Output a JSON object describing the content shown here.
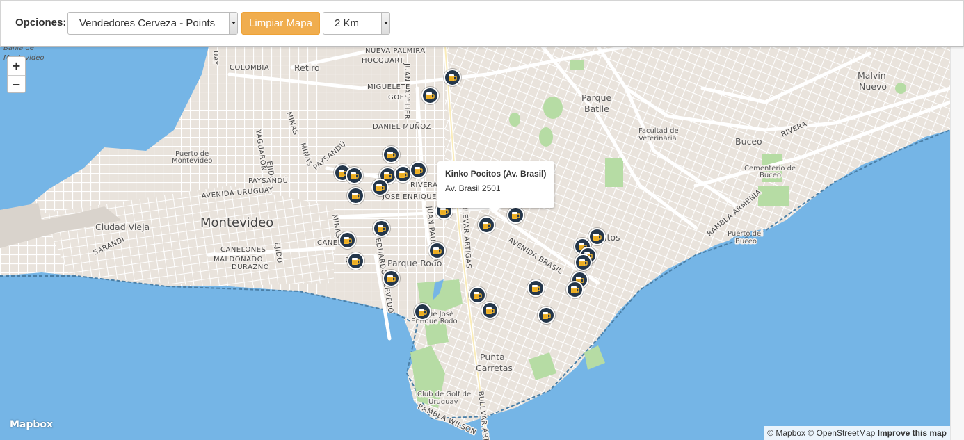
{
  "toolbar": {
    "options_label": "Opciones:",
    "layer_select": "Vendedores Cerveza - Points",
    "clear_button": "Limpiar Mapa",
    "radius_select": "2 Km",
    "accent_color": "#f0ad4e"
  },
  "map": {
    "zoom_in": "+",
    "zoom_out": "−",
    "popup": {
      "name": "Kinko Pocitos (Av. Brasil)",
      "address": "Av. Brasil 2501"
    },
    "marker_icon": "beer-mug-icon",
    "marker_count": 34,
    "logo": "Mapbox",
    "attribution": {
      "mapbox": "© Mapbox",
      "osm": "© OpenStreetMap",
      "improve": "Improve this map"
    },
    "labels": {
      "bahia": [
        "Bahía de",
        "Montevideo"
      ],
      "colombia": "COLOMBIA",
      "retiro": "Retiro",
      "nueva_palmira": "NUEVA PALMIRA",
      "hocquart": "HOCQUART",
      "juan_paullier": "JUAN PAULLIER",
      "miguelete": "MIGUELETE",
      "goes": "GOES",
      "daniel_munoz": "DANIEL MUÑOZ",
      "parque_batle": [
        "Parque",
        "Batlle"
      ],
      "malvin_nuevo": [
        "Malvín",
        "Nuevo"
      ],
      "facultad": [
        "Facultad de",
        "Veterinaria"
      ],
      "rivera_east": "RIVERA",
      "buceo": "Buceo",
      "cementerio": [
        "Cementerio de",
        "Buceo"
      ],
      "puerto_montevideo": [
        "Puerto de",
        "Montevideo"
      ],
      "yaguaron": "YAGUARON",
      "ejido": "EJIDO",
      "minas1": "MINAS",
      "minas2": "MINAS",
      "paysandu": "PAYSANDÚ",
      "paysandu2": "PAYSANDÚ",
      "avenida_uruguay": "AVENIDA URUGUAY",
      "rivera": "RIVERA",
      "jose_enrique_rodo": "JOSÉ ENRIQUE R",
      "ciudad_vieja": "Ciudad Vieja",
      "montevideo": "Montevideo",
      "sarandi": "SARANDI",
      "canelones": "CANELONES",
      "maldonado": "MALDONADO",
      "durazno": "DURAZNO",
      "ejido2": "EJIDO",
      "canelones2": "CANEL",
      "minas3": "MINAS",
      "durazno2": "D",
      "eduardo_acevedo": "EDUARDO ACEVEDO",
      "parque_rodo": "Parque Rodo",
      "juan_paullier2": "JUAN PAULLIER",
      "bulevar_artigas": "BULEVAR ARTIGAS",
      "avenida_brasil": "AVENIDA BRASIL",
      "pocitos": "itos",
      "rambla_armenia": "RAMBLA ARMENIA",
      "puerto_buceo": [
        "Puerto del",
        "Buceo"
      ],
      "parque_jose": [
        "Parque José",
        "Enrique Rodo"
      ],
      "punta_carretas": [
        "Punta",
        "Carretas"
      ],
      "club_golf": [
        "Club de Golf del",
        "Uruguay"
      ],
      "rambla_wilson": "RAMBLA WILSON",
      "bulevar_artigas2": "BULEVAR ARTIG",
      "uay": "UAY"
    }
  }
}
